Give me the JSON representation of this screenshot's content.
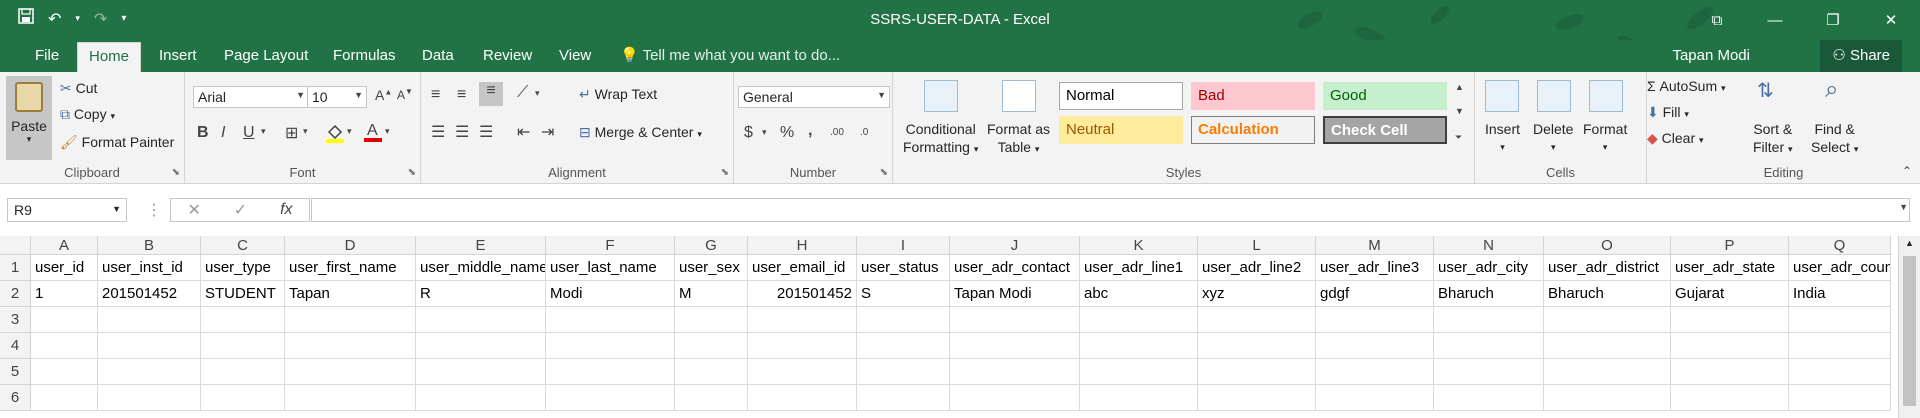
{
  "window": {
    "title": "SSRS-USER-DATA - Excel",
    "qat": [
      "save-icon",
      "undo-icon",
      "redo-icon",
      "customize-icon"
    ],
    "controls": [
      "ribbon-display-icon",
      "minimize-icon",
      "restore-icon",
      "close-icon"
    ]
  },
  "tabs": [
    "File",
    "Home",
    "Insert",
    "Page Layout",
    "Formulas",
    "Data",
    "Review",
    "View"
  ],
  "active_tab": "Home",
  "tell_me": "Tell me what you want to do...",
  "user_name": "Tapan Modi",
  "share_label": "Share",
  "clipboard": {
    "paste": "Paste",
    "cut": "Cut",
    "copy": "Copy",
    "format_painter": "Format Painter",
    "label": "Clipboard"
  },
  "font": {
    "name": "Arial",
    "size": "10",
    "bold": "B",
    "italic": "I",
    "underline": "U",
    "label": "Font"
  },
  "alignment": {
    "wrap_text": "Wrap Text",
    "merge_center": "Merge & Center",
    "label": "Alignment"
  },
  "number": {
    "format": "General",
    "currency": "$",
    "percent": "%",
    "comma": ",",
    "inc_decimal": ".00",
    "dec_decimal": ".0",
    "label": "Number"
  },
  "styles": {
    "conditional_formatting": [
      "Conditional",
      "Formatting"
    ],
    "format_as_table": [
      "Format as",
      "Table"
    ],
    "cells": [
      {
        "label": "Normal",
        "bg": "#ffffff",
        "fg": "#000000",
        "border": "#a6a6a6"
      },
      {
        "label": "Bad",
        "bg": "#ffc7ce",
        "fg": "#9c0006",
        "border": "#ffc7ce"
      },
      {
        "label": "Good",
        "bg": "#c6efce",
        "fg": "#006100",
        "border": "#c6efce"
      },
      {
        "label": "Neutral",
        "bg": "#ffeb9c",
        "fg": "#9c5700",
        "border": "#ffeb9c"
      },
      {
        "label": "Calculation",
        "bg": "#f2f2f2",
        "fg": "#fa7d00",
        "border": "#7f7f7f"
      },
      {
        "label": "Check Cell",
        "bg": "#a5a5a5",
        "fg": "#ffffff",
        "border": "#3f3f3f"
      }
    ],
    "label": "Styles"
  },
  "cells_group": {
    "insert": "Insert",
    "delete": "Delete",
    "format": "Format",
    "label": "Cells"
  },
  "editing": {
    "autosum": "AutoSum",
    "fill": "Fill",
    "clear": "Clear",
    "sort_filter": [
      "Sort &",
      "Filter"
    ],
    "find_select": [
      "Find &",
      "Select"
    ],
    "label": "Editing"
  },
  "formula_bar": {
    "name_box": "R9",
    "fx": "fx",
    "formula": ""
  },
  "sheet": {
    "columns": [
      "A",
      "B",
      "C",
      "D",
      "E",
      "F",
      "G",
      "H",
      "I",
      "J",
      "K",
      "L",
      "M",
      "N",
      "O",
      "P",
      "Q"
    ],
    "rows": [
      "1",
      "2",
      "3",
      "4",
      "5",
      "6"
    ],
    "data": [
      [
        "user_id",
        "user_inst_id",
        "user_type",
        "user_first_name",
        "user_middle_name",
        "user_last_name",
        "user_sex",
        "user_email_id",
        "user_status",
        "user_adr_contact",
        "user_adr_line1",
        "user_adr_line2",
        "user_adr_line3",
        "user_adr_city",
        "user_adr_district",
        "user_adr_state",
        "user_adr_country"
      ],
      [
        "1",
        "201501452",
        "STUDENT",
        "Tapan",
        "R",
        "Modi",
        "M",
        "201501452",
        "S",
        "Tapan Modi",
        "abc",
        "xyz",
        "gdgf",
        "Bharuch",
        "Bharuch",
        "Gujarat",
        "India"
      ]
    ],
    "numeric_cells": [
      "2-7"
    ]
  },
  "colors": {
    "excel_green": "#217346",
    "ribbon_bg": "#f3f3f3"
  }
}
